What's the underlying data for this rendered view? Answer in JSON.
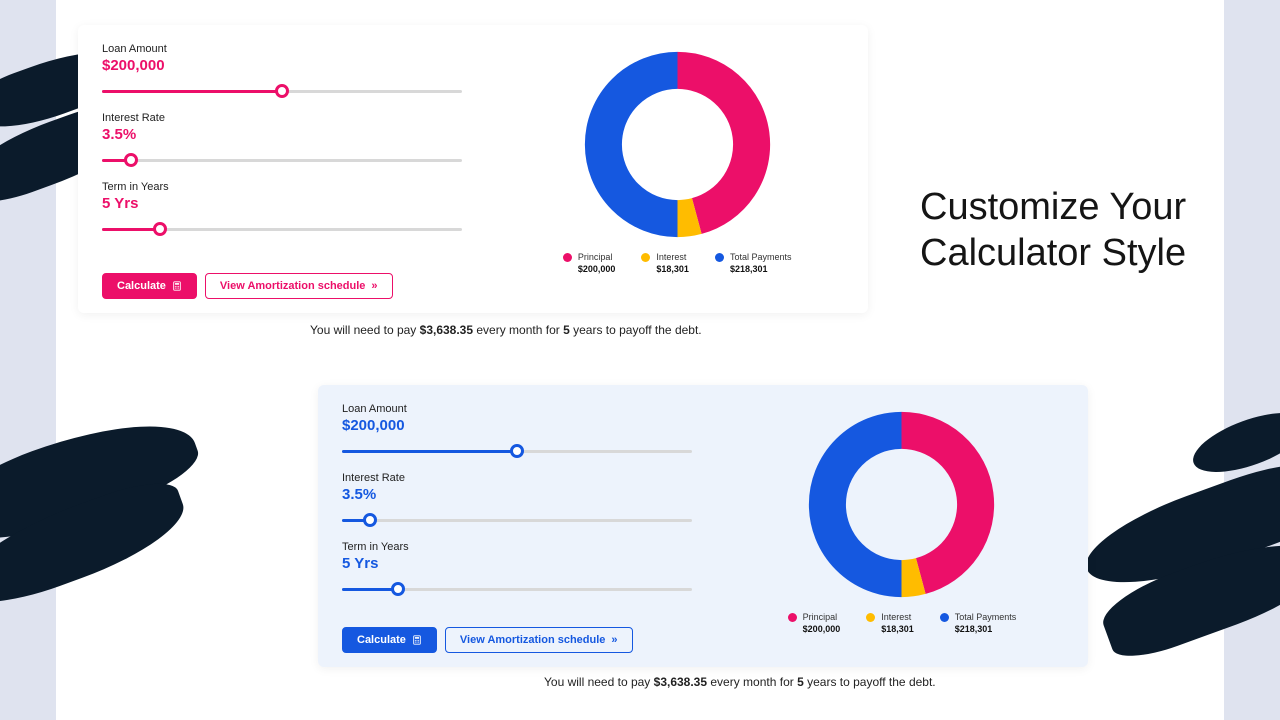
{
  "heading": "Customize Your\nCalculator Style",
  "colors": {
    "pink": "#ec0f69",
    "blue": "#1558e0",
    "yellow": "#ffbc00",
    "chart_blue": "#1558e0",
    "chart_pink": "#ec0f69",
    "chart_yellow": "#ffbc00"
  },
  "calc": {
    "loan_label": "Loan Amount",
    "loan_value": "$200,000",
    "loan_pct": 50,
    "rate_label": "Interest Rate",
    "rate_value": "3.5%",
    "rate_pct": 8,
    "term_label": "Term in Years",
    "term_value": "5 Yrs",
    "term_pct": 16,
    "btn_calc": "Calculate",
    "btn_amort": "View Amortization schedule",
    "legend": {
      "principal_label": "Principal",
      "principal_value": "$200,000",
      "interest_label": "Interest",
      "interest_value": "$18,301",
      "total_label": "Total Payments",
      "total_value": "$218,301"
    },
    "summary": {
      "prefix": "You will need to pay ",
      "amount": "$3,638.35",
      "mid": " every month for ",
      "years": "5",
      "suffix": " years to payoff the debt."
    }
  },
  "chart_data": {
    "type": "pie",
    "title": "",
    "series": [
      {
        "name": "Principal",
        "value": 200000,
        "color": "#ec0f69"
      },
      {
        "name": "Interest",
        "value": 18301,
        "color": "#ffbc00"
      },
      {
        "name": "Total Payments",
        "value": 218301,
        "color": "#1558e0"
      }
    ],
    "note": "Donut chart visually shows Principal (pink, ~right half), Interest (yellow, small slice at bottom), Total Payments (blue, ~left half). Angles approximate the ratio of each to the sum of all three values."
  }
}
